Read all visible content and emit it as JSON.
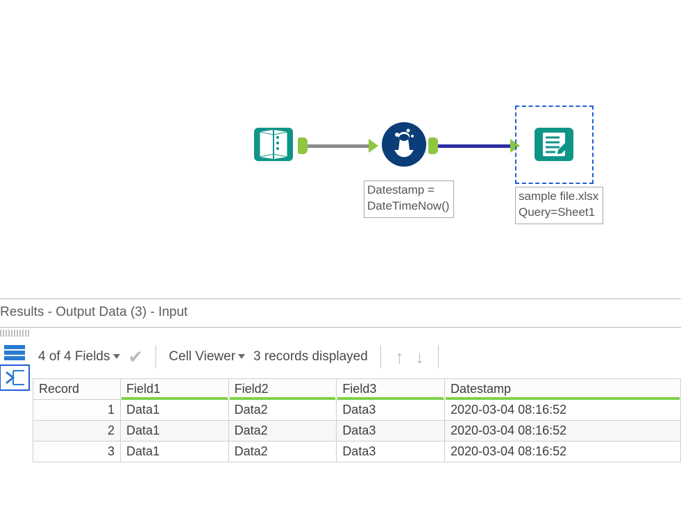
{
  "workflow": {
    "formula_annotation": "Datestamp =\nDateTimeNow()",
    "output_annotation": "sample file.xlsx\nQuery=Sheet1"
  },
  "results": {
    "title": "Results - Output Data (3) - Input",
    "fields_label": "4 of 4 Fields",
    "cellviewer_label": "Cell Viewer",
    "records_label": "3 records displayed",
    "columns": [
      "Record",
      "Field1",
      "Field2",
      "Field3",
      "Datestamp"
    ],
    "rows": [
      {
        "n": "1",
        "Field1": "Data1",
        "Field2": "Data2",
        "Field3": "Data3",
        "Datestamp": "2020-03-04 08:16:52"
      },
      {
        "n": "2",
        "Field1": "Data1",
        "Field2": "Data2",
        "Field3": "Data3",
        "Datestamp": "2020-03-04 08:16:52"
      },
      {
        "n": "3",
        "Field1": "Data1",
        "Field2": "Data2",
        "Field3": "Data3",
        "Datestamp": "2020-03-04 08:16:52"
      }
    ]
  }
}
